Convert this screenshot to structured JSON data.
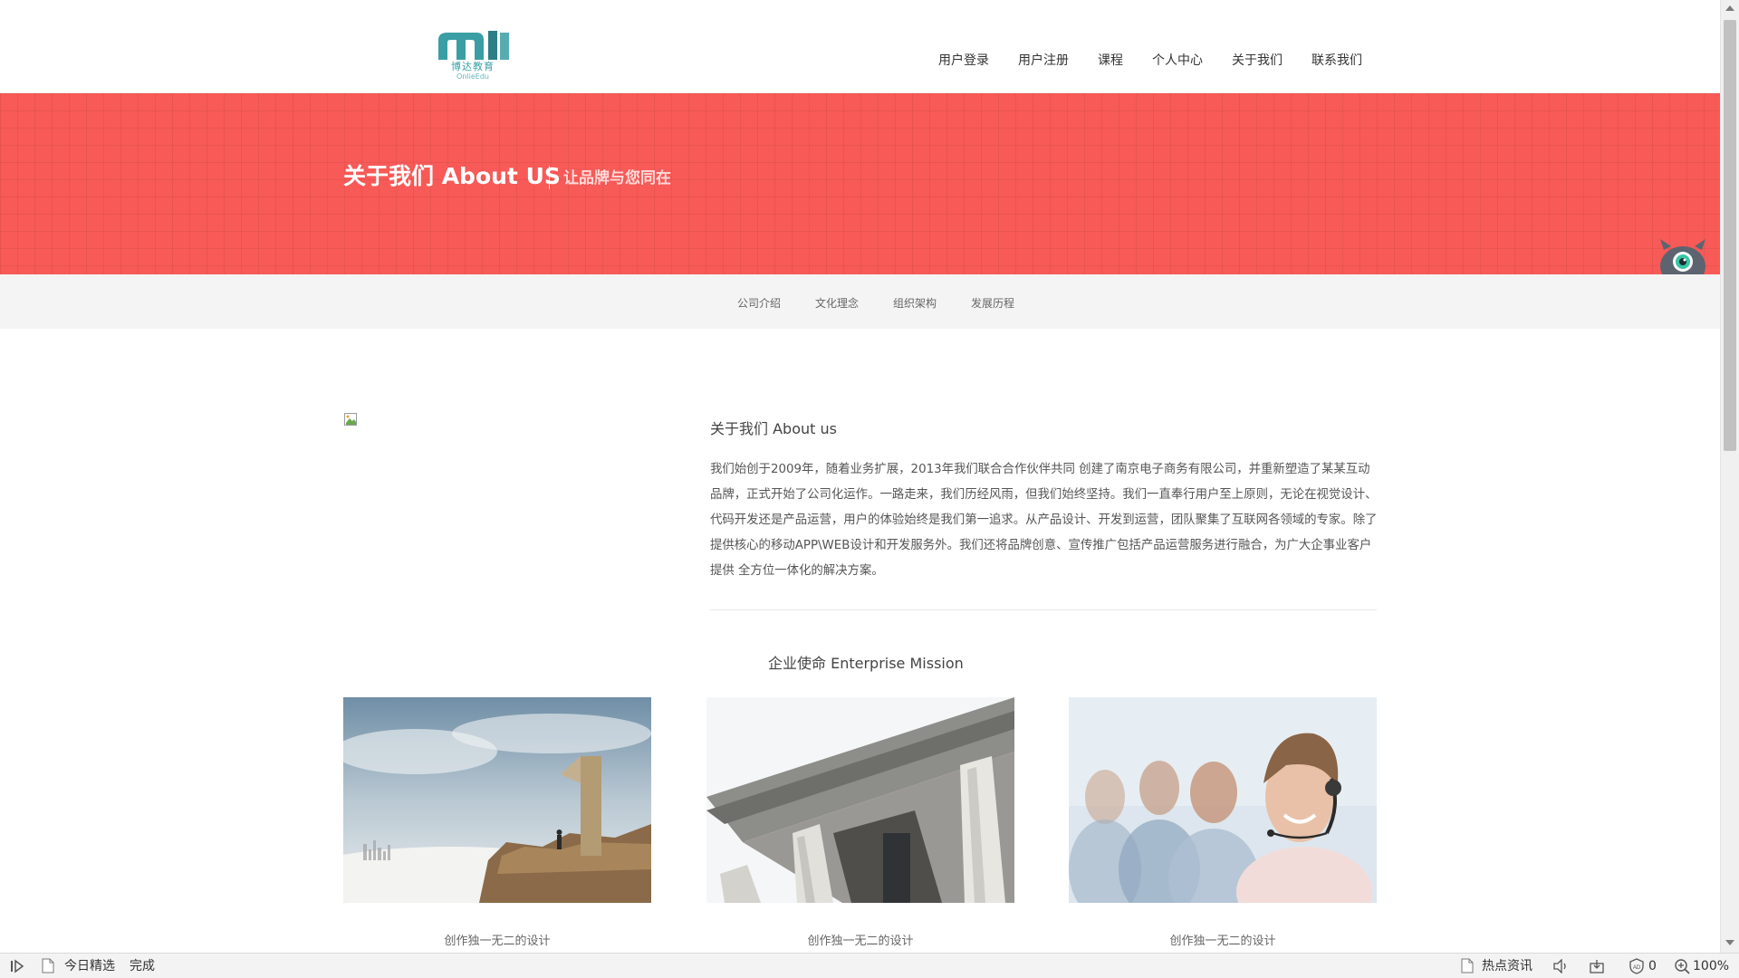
{
  "header": {
    "logo_text": "博达教育",
    "logo_subtext": "OnlieEdu",
    "nav": [
      "用户登录",
      "用户注册",
      "课程",
      "个人中心",
      "关于我们",
      "联系我们"
    ]
  },
  "banner": {
    "title": "关于我们 About US",
    "slogan": "让品牌与您同在",
    "accent_color": "#f85a57"
  },
  "subnav": [
    "公司介绍",
    "文化理念",
    "组织架构",
    "发展历程"
  ],
  "about": {
    "heading": "关于我们 About us",
    "body": "我们始创于2009年，随着业务扩展，2013年我们联合合作伙伴共同 创建了南京电子商务有限公司，并重新塑造了某某互动品牌，正式开始了公司化运作。一路走来，我们历经风雨，但我们始终坚持。我们一直奉行用户至上原则，无论在视觉设计、代码开发还是产品运营，用户的体验始终是我们第一追求。从产品设计、开发到运营，团队聚集了互联网各领域的专家。除了提供核心的移动APP\\WEB设计和开发服务外。我们还将品牌创意、宣传推广包括产品运营服务进行融合，为广大企事业客户提供 全方位一体化的解决方案。"
  },
  "mission": {
    "heading": "企业使命 Enterprise Mission",
    "cards": [
      {
        "caption": "创作独一无二的设计"
      },
      {
        "caption": "创作独一无二的设计"
      },
      {
        "caption": "创作独一无二的设计"
      }
    ]
  },
  "statusbar": {
    "left_label": "今日精选",
    "status": "完成",
    "news_label": "热点资讯",
    "counter": "0",
    "zoom": "100%"
  }
}
